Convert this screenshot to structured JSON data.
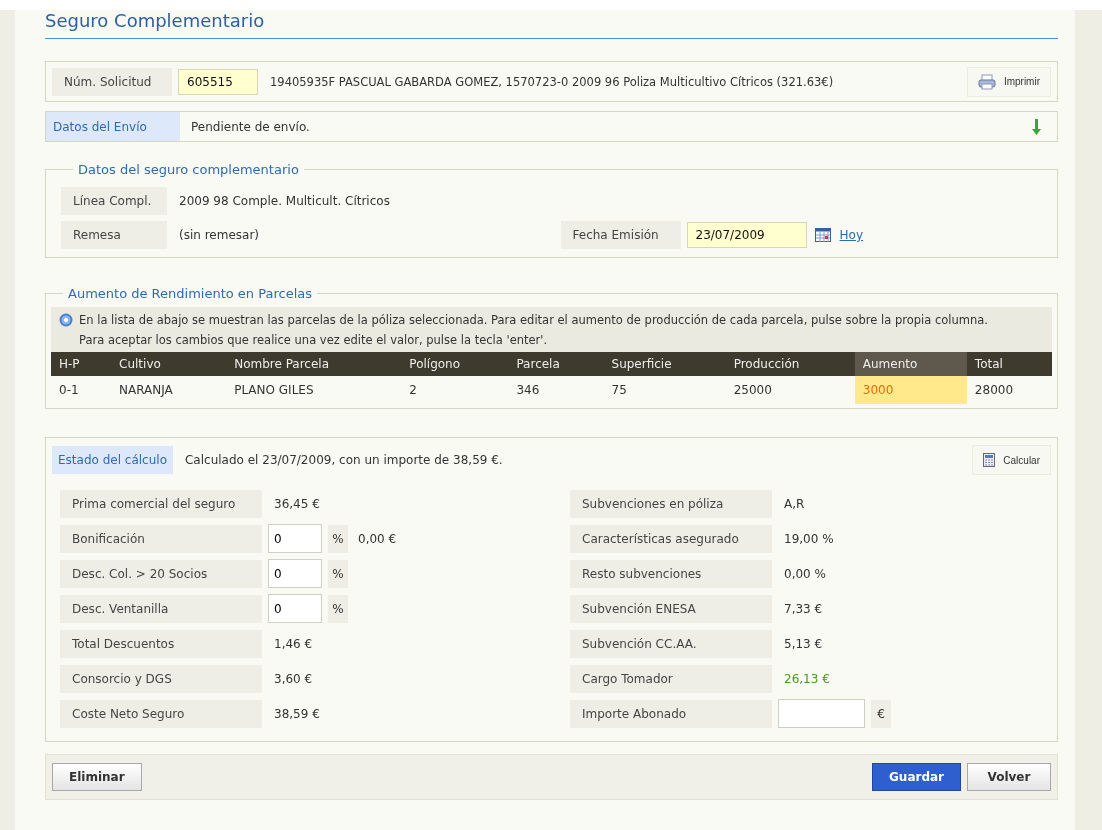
{
  "title": "Seguro Complementario",
  "solicitud": {
    "label": "Núm. Solicitud",
    "value": "605515",
    "description": "19405935F PASCUAL GABARDA GOMEZ, 1570723-0 2009 96 Poliza Multicultivo Cítricos (321.63€)",
    "print_button": "Imprimir"
  },
  "envio": {
    "label": "Datos del Envío",
    "value": "Pendiente de envío."
  },
  "complementario": {
    "legend": "Datos del seguro complementario",
    "linea": {
      "label": "Línea Compl.",
      "value": "2009 98 Comple. Multicult. Cítricos"
    },
    "remesa": {
      "label": "Remesa",
      "value": "(sin remesar)"
    },
    "fecha": {
      "label": "Fecha Emisión",
      "value": "23/07/2009",
      "link": "Hoy"
    }
  },
  "parcelas": {
    "legend": "Aumento de Rendimiento en Parcelas",
    "info": "En la lista de abajo se muestran las parcelas de la póliza seleccionada. Para editar el aumento de producción de cada parcela, pulse sobre la propia columna. Para aceptar los cambios que realice una vez edite el valor, pulse la tecla 'enter'.",
    "columns": [
      {
        "label": "H-P",
        "editable": false
      },
      {
        "label": "Cultivo",
        "editable": false
      },
      {
        "label": "Nombre Parcela",
        "editable": false
      },
      {
        "label": "Polígono",
        "editable": false
      },
      {
        "label": "Parcela",
        "editable": false
      },
      {
        "label": "Superficie",
        "editable": false
      },
      {
        "label": "Producción",
        "editable": false
      },
      {
        "label": "Aumento",
        "editable": true
      },
      {
        "label": "Total",
        "editable": false
      }
    ],
    "rows": [
      [
        "0-1",
        "NARANJA",
        "PLANO GILES",
        "2",
        "346",
        "75",
        "25000",
        "3000",
        "28000"
      ]
    ]
  },
  "calculo": {
    "label": "Estado del cálculo",
    "status": "Calculado el 23/07/2009, con un importe de 38,59 €.",
    "button": "Calcular",
    "left": [
      {
        "kind": "value",
        "label": "Prima comercial del seguro",
        "value": "36,45 €"
      },
      {
        "kind": "input",
        "label": "Bonificación",
        "value": "0",
        "unit": "%",
        "extra": "0,00 €"
      },
      {
        "kind": "input",
        "label": "Desc. Col. > 20 Socios",
        "value": "0",
        "unit": "%"
      },
      {
        "kind": "input",
        "label": "Desc. Ventanilla",
        "value": "0",
        "unit": "%"
      },
      {
        "kind": "value",
        "label": "Total Descuentos",
        "value": "1,46 €"
      },
      {
        "kind": "value",
        "label": "Consorcio y DGS",
        "value": "3,60 €"
      },
      {
        "kind": "value",
        "label": "Coste Neto Seguro",
        "value": "38,59 €"
      }
    ],
    "right": [
      {
        "kind": "value",
        "label": "Subvenciones en póliza",
        "value": "A,R"
      },
      {
        "kind": "value",
        "label": "Características asegurado",
        "value": "19,00 %"
      },
      {
        "kind": "value",
        "label": "Resto subvenciones",
        "value": "0,00 %"
      },
      {
        "kind": "value",
        "label": "Subvención ENESA",
        "value": "7,33 €"
      },
      {
        "kind": "value",
        "label": "Subvención CC.AA.",
        "value": "5,13 €"
      },
      {
        "kind": "accent",
        "label": "Cargo Tomador",
        "value": "26,13 €"
      },
      {
        "kind": "input",
        "label": "Importe Abonado",
        "unit": "€"
      }
    ]
  },
  "footer": {
    "left": [
      {
        "label": "Eliminar",
        "kind": "default"
      }
    ],
    "right": [
      {
        "label": "Guardar",
        "kind": "primary"
      },
      {
        "label": "Volver",
        "kind": "default"
      }
    ]
  }
}
